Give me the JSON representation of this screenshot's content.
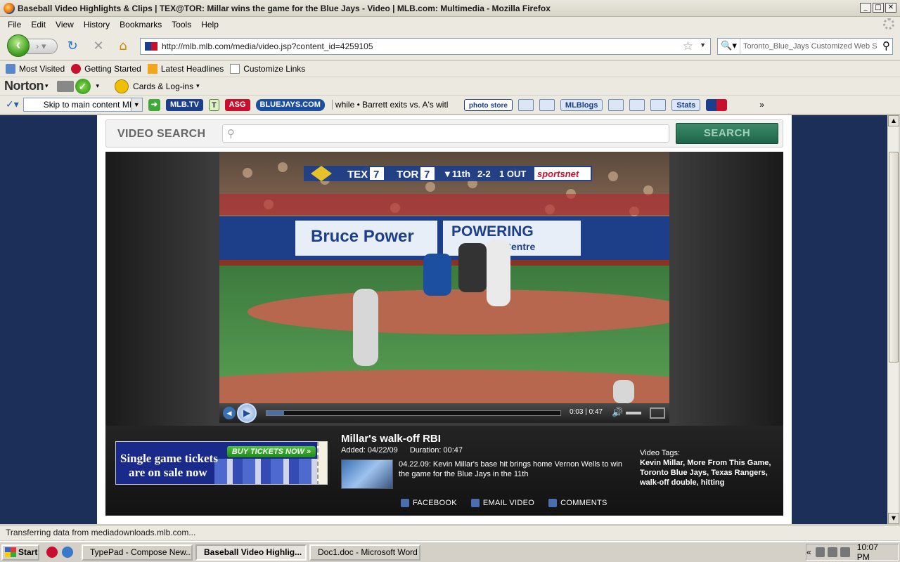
{
  "window": {
    "title": "Baseball Video Highlights & Clips | TEX@TOR: Millar wins the game for the Blue Jays - Video | MLB.com: Multimedia - Mozilla Firefox",
    "min": "_",
    "max": "□",
    "close": "✕"
  },
  "menu": [
    "File",
    "Edit",
    "View",
    "History",
    "Bookmarks",
    "Tools",
    "Help"
  ],
  "nav": {
    "url": "http://mlb.mlb.com/media/video.jsp?content_id=4259105",
    "search_text": "Toronto_Blue_Jays Customized Web Se..."
  },
  "bookmarks": [
    "Most Visited",
    "Getting Started",
    "Latest Headlines",
    "Customize Links"
  ],
  "norton": {
    "brand": "Norton",
    "cards": "Cards & Log-ins"
  },
  "mlb_toolbar": {
    "skip": "Skip to main content MLB.",
    "mlbtv": "MLB.TV",
    "bluejays": "BLUEJAYS.COM",
    "ticker": "while • Barrett exits vs. A's witl",
    "photo_store": "photo store",
    "mlblogs": "MLBlogs",
    "stats": "Stats"
  },
  "page": {
    "search_label": "VIDEO SEARCH",
    "search_placeholder": "",
    "search_button": "SEARCH",
    "scorebug": {
      "away": "TEX",
      "away_score": "7",
      "home": "TOR",
      "home_score": "7",
      "inning": "▼11th",
      "count": "2-2",
      "outs": "1 OUT",
      "network": "sportsnet"
    },
    "player": {
      "time": "0:03 | 0:47",
      "progress": 0.06
    },
    "ad": {
      "line1": "Single game tickets",
      "line2": "are on sale now",
      "button": "BUY TICKETS NOW »"
    },
    "video": {
      "title": "Millar's walk-off RBI",
      "added": "Added: 04/22/09",
      "duration": "Duration: 00:47",
      "description": "04.22.09: Kevin Millar's base hit brings home Vernon Wells to win the game for the Blue Jays in the 11th",
      "tags_label": "Video Tags:",
      "tags": "Kevin Millar, More From This Game, Toronto Blue Jays, Texas Rangers, walk-off double, hitting"
    },
    "actions": [
      "FACEBOOK",
      "EMAIL VIDEO",
      "COMMENTS"
    ]
  },
  "status": "Transferring data from mediadownloads.mlb.com...",
  "taskbar": {
    "start": "Start",
    "tasks": [
      "TypePad - Compose New...",
      "Baseball Video Highlig...",
      "Doc1.doc - Microsoft Word"
    ],
    "clock": "10:07 PM"
  }
}
